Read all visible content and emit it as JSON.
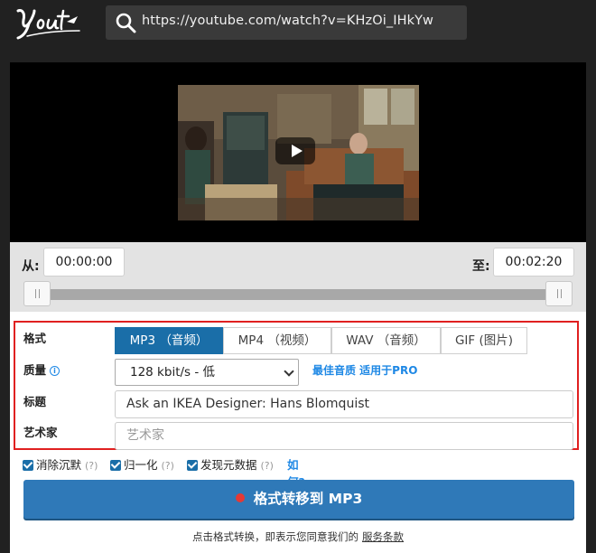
{
  "header": {
    "logo_text": "Yout",
    "url": "https://youtube.com/watch?v=KHzOi_IHkYw"
  },
  "player": {
    "play_icon": "play-icon"
  },
  "trim": {
    "from_label": "从:",
    "from_time": "00:00:00",
    "to_label": "至:",
    "to_time": "00:02:20",
    "range": [
      0,
      1
    ]
  },
  "options": {
    "format_label": "格式",
    "formats": [
      "MP3 （音频）",
      "MP4 （视频）",
      "WAV （音频）",
      "GIF (图片)"
    ],
    "active_format": "MP3 （音频）",
    "quality_label": "质量",
    "quality_value": "128 kbit/s - 低",
    "best_quality_link": "最佳音质 适用于PRO",
    "title_label": "标题",
    "title_value": "Ask an IKEA Designer: Hans Blomquist",
    "artist_label": "艺术家",
    "artist_placeholder": "艺术家"
  },
  "checkboxes": [
    {
      "label": "消除沉默",
      "checked": true,
      "help": "(?)"
    },
    {
      "label": "归一化",
      "checked": true,
      "help": "(?)"
    },
    {
      "label": "发现元数据",
      "checked": true,
      "help": "(?)"
    }
  ],
  "how_link": "如何?",
  "convert_button": "格式转移到 MP3",
  "terms": {
    "text": "点击格式转换，即表示您同意我们的",
    "link": "服务条款"
  },
  "colors": {
    "accent": "#1a6ea8",
    "button": "#2f79b8",
    "highlight_border": "#e02020",
    "record_dot": "#e53935"
  }
}
